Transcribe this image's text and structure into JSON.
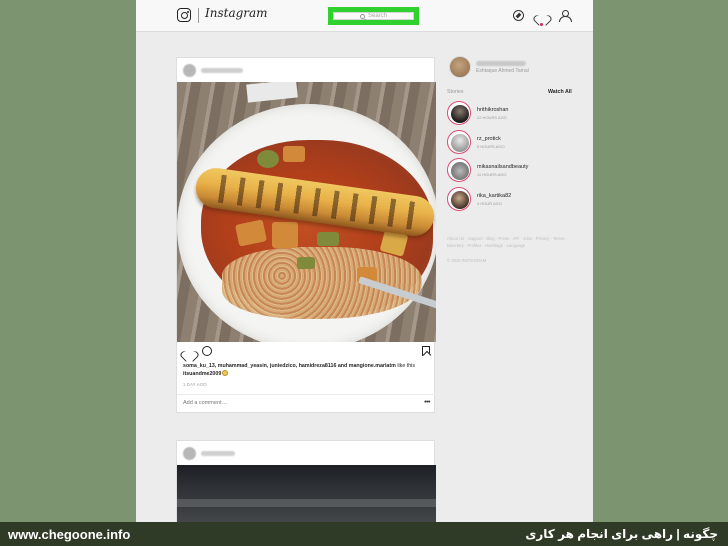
{
  "header": {
    "brand": "Instagram",
    "search_placeholder": "Search"
  },
  "post": {
    "likes_users": "soma_ku_13, muhammad_yeasin, juniedzico, hamidreza8116 and mangione.mariatm",
    "likes_suffix": " like this",
    "likes_last": "itsuandme2009",
    "time_ago": "1 DAY AGO",
    "comment_placeholder": "Add a comment…",
    "more_label": "•••"
  },
  "sidebar": {
    "profile_full_name": "Eshtaque Ahmed Tamal",
    "stories_title": "Stories",
    "watch_all": "Watch All",
    "stories": [
      {
        "username": "hrithikroshan",
        "time": "22 HOURS AGO"
      },
      {
        "username": "rz_protick",
        "time": "5 HOURS AGO"
      },
      {
        "username": "mikasnailsandbeauty",
        "time": "11 HOURS AGO"
      },
      {
        "username": "rika_kartika82",
        "time": "4 HOUR AGO"
      }
    ],
    "footer_links": "About Us · Support · Blog · Press · API · Jobs · Privacy · Terms · Directory · Profiles · Hashtags · Language",
    "copyright": "© 2018 INSTAGRAM"
  },
  "watermark": {
    "left": "www.chegoone.info",
    "right": "چگونه | راهی برای انجام هر کاری"
  },
  "colors": {
    "highlight": "#2fd12f",
    "notification": "#e0245e",
    "story_ring": "#d94a72",
    "background": "#7d9470"
  }
}
